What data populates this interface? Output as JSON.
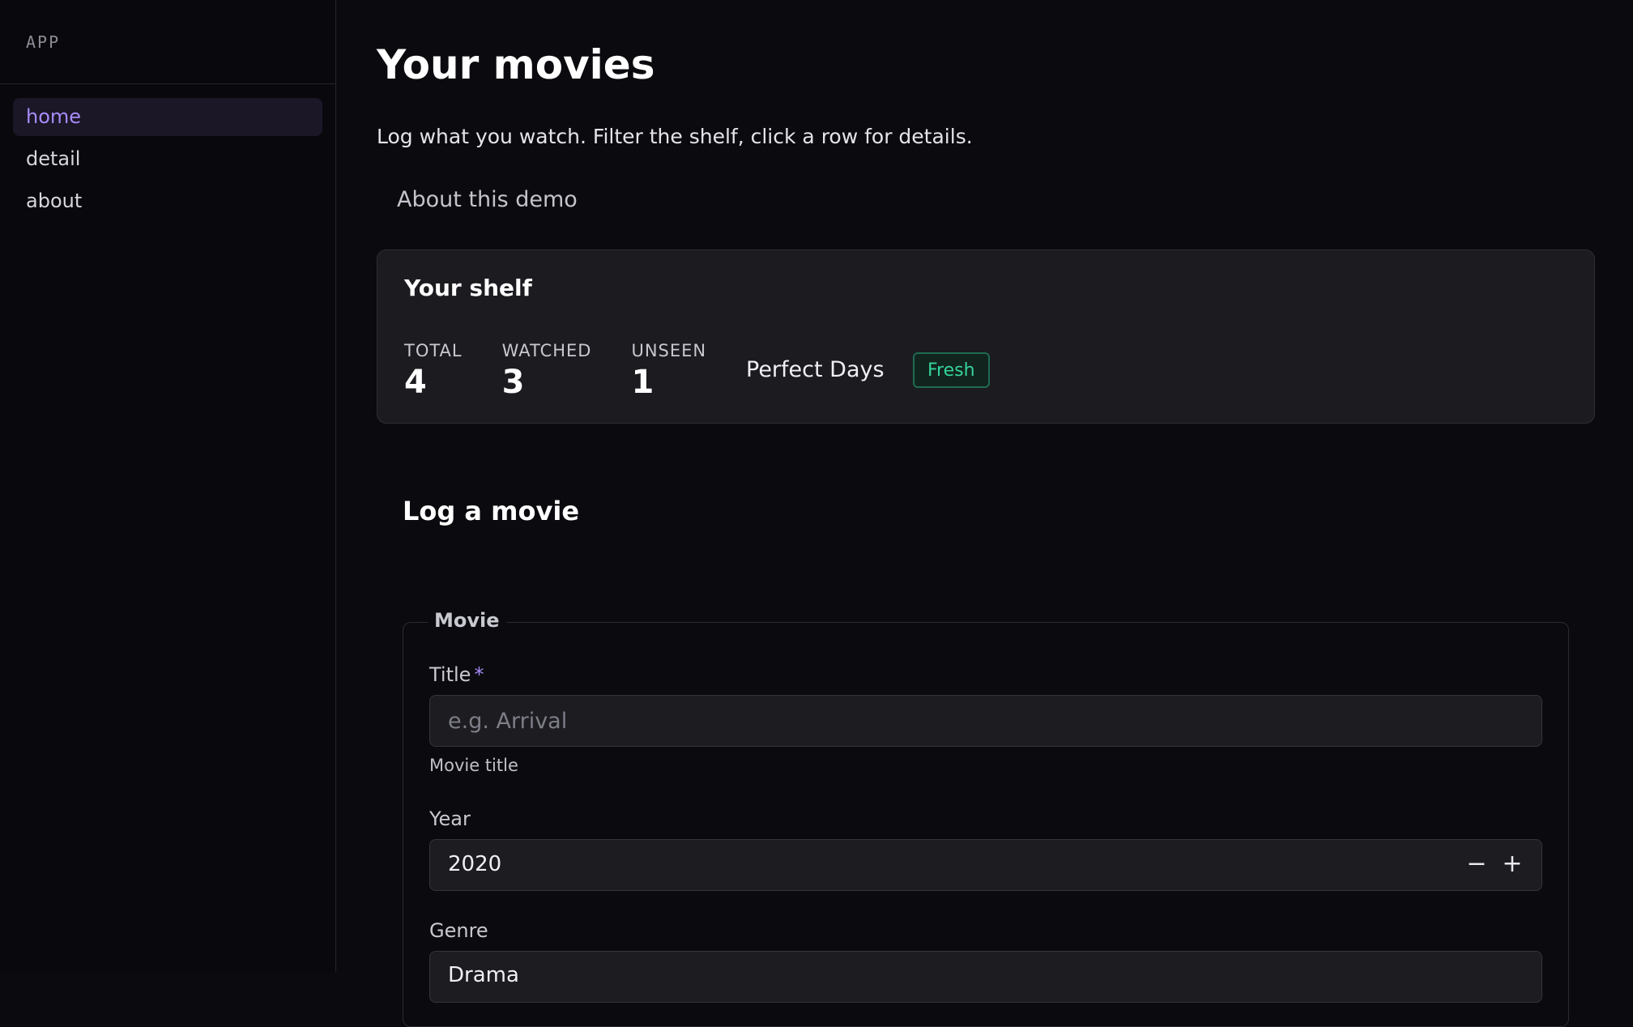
{
  "sidebar": {
    "brand": "APP",
    "items": [
      {
        "label": "home",
        "active": true
      },
      {
        "label": "detail",
        "active": false
      },
      {
        "label": "about",
        "active": false
      }
    ]
  },
  "main": {
    "title": "Your movies",
    "subtitle": "Log what you watch. Filter the shelf, click a row for details.",
    "about_link": "About this demo",
    "shelf": {
      "title": "Your shelf",
      "stats": [
        {
          "label": "TOTAL",
          "value": "4"
        },
        {
          "label": "WATCHED",
          "value": "3"
        },
        {
          "label": "UNSEEN",
          "value": "1"
        }
      ],
      "featured_title": "Perfect Days",
      "badge": "Fresh",
      "badge_color": "#34d399"
    },
    "form": {
      "section_title": "Log a movie",
      "legend": "Movie",
      "title_label": "Title",
      "required_mark": "*",
      "title_placeholder": "e.g. Arrival",
      "title_hint": "Movie title",
      "year_label": "Year",
      "year_value": "2020",
      "decrement_icon": "minus-icon",
      "increment_icon": "plus-icon",
      "genre_label": "Genre",
      "genre_value": "Drama"
    }
  },
  "colors": {
    "accent": "#a78bfa",
    "background": "#0b0b0f",
    "card": "#1b1b20"
  }
}
